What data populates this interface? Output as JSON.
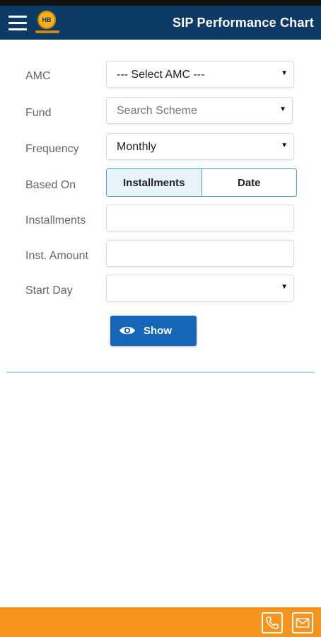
{
  "header": {
    "title": "SIP Performance Chart",
    "logo_text": "HB",
    "menu_icon": "hamburger-menu-icon"
  },
  "form": {
    "amc": {
      "label": "AMC",
      "value": "--- Select AMC ---"
    },
    "fund": {
      "label": "Fund",
      "placeholder": "Search Scheme"
    },
    "frequency": {
      "label": "Frequency",
      "value": "Monthly"
    },
    "based_on": {
      "label": "Based On",
      "options": [
        "Installments",
        "Date"
      ],
      "selected": "Installments"
    },
    "installments": {
      "label": "Installments",
      "value": ""
    },
    "inst_amount": {
      "label": "Inst. Amount",
      "value": ""
    },
    "start_day": {
      "label": "Start Day",
      "value": ""
    }
  },
  "actions": {
    "show_label": "Show",
    "show_icon": "eye-icon"
  },
  "footer": {
    "icons": [
      "phone-icon",
      "mail-icon"
    ]
  },
  "colors": {
    "header_bg": "#0e3a66",
    "accent_blue": "#1566b7",
    "footer_orange": "#f7941d",
    "segment_border": "#4aa3b5"
  }
}
